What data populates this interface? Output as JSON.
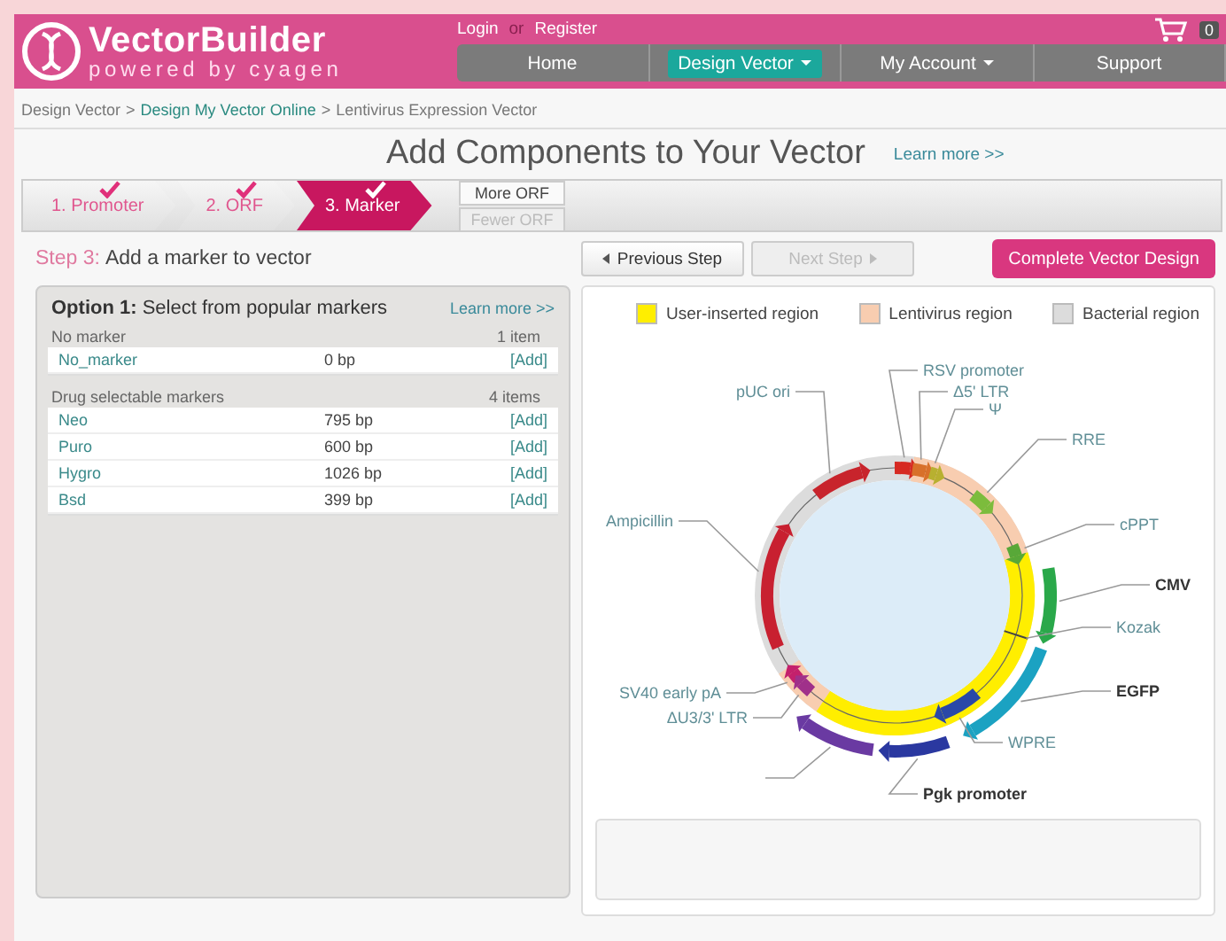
{
  "header": {
    "brand": "VectorBuilder",
    "tagline": "powered by cyagen",
    "login": "Login",
    "or": "or",
    "register": "Register",
    "cart_count": "0"
  },
  "nav": [
    {
      "label": "Home",
      "selected": false,
      "dropdown": false
    },
    {
      "label": "Design Vector",
      "selected": true,
      "dropdown": true
    },
    {
      "label": "My Account",
      "selected": false,
      "dropdown": true
    },
    {
      "label": "Support",
      "selected": false,
      "dropdown": false
    }
  ],
  "breadcrumb": [
    {
      "label": "Design Vector",
      "link": false
    },
    {
      "label": "Design My Vector Online",
      "link": true
    },
    {
      "label": "Lentivirus Expression Vector",
      "link": false
    }
  ],
  "breadcrumb_separator": ">",
  "title": "Add Components to Your Vector",
  "title_link": "Learn more >>",
  "steps": [
    {
      "label": "1. Promoter",
      "selected": false,
      "done": true
    },
    {
      "label": "2. ORF",
      "selected": false,
      "done": true
    },
    {
      "label": "3. Marker",
      "selected": true,
      "done": true
    }
  ],
  "orf_buttons": [
    {
      "label": "More ORF",
      "disabled": false
    },
    {
      "label": "Fewer ORF",
      "disabled": true
    }
  ],
  "step_heading": {
    "step": "Step 3:",
    "text": "Add a marker to vector"
  },
  "option": {
    "title": "**Option 1:** Select from popular markers",
    "link": "Learn more >>"
  },
  "marker_groups": [
    {
      "name": "No marker",
      "count": "1 item",
      "markers": [
        {
          "name": "No_marker",
          "size": "0 bp",
          "action": "[Add]"
        }
      ]
    },
    {
      "name": "Drug selectable markers",
      "count": "4 items",
      "markers": [
        {
          "name": "Neo",
          "size": "795 bp",
          "action": "[Add]"
        },
        {
          "name": "Puro",
          "size": "600 bp",
          "action": "[Add]"
        },
        {
          "name": "Hygro",
          "size": "1026 bp",
          "action": "[Add]"
        },
        {
          "name": "Bsd",
          "size": "399 bp",
          "action": "[Add]"
        }
      ]
    }
  ],
  "nav_buttons": [
    {
      "label": "Previous Step",
      "kind": "prev",
      "disabled": false
    },
    {
      "label": "Next Step",
      "kind": "next",
      "disabled": true
    }
  ],
  "complete_button": "Complete Vector Design",
  "legend": [
    {
      "label": "User-inserted region",
      "kind": "user",
      "color": "#ffee00"
    },
    {
      "label": "Lentivirus region",
      "kind": "lentivirus",
      "color": "#f8cdb0"
    },
    {
      "label": "Bacterial region",
      "kind": "bacterial",
      "color": "#dcdcdc"
    }
  ],
  "features": [
    {
      "label": "RSV promoter",
      "kind": "arrow",
      "user_inserted": false,
      "color": "#d62a22"
    },
    {
      "label": "pUC ori",
      "kind": "arrow",
      "user_inserted": false,
      "color": "#c8242c"
    },
    {
      "label": "Δ5' LTR",
      "kind": "arrow",
      "user_inserted": false,
      "color": "#d8702a"
    },
    {
      "label": "Ψ",
      "kind": "arrow",
      "user_inserted": false,
      "color": "#b8b030"
    },
    {
      "label": "RRE",
      "kind": "arrow",
      "user_inserted": false,
      "color": "#7cbc3c"
    },
    {
      "label": "Ampicillin",
      "kind": "arrow",
      "user_inserted": false,
      "color": "#c82030"
    },
    {
      "label": "cPPT",
      "kind": "arrow",
      "user_inserted": false,
      "color": "#58a838"
    },
    {
      "label": "CMV",
      "kind": "arrow",
      "user_inserted": true,
      "color": "#2aa84a"
    },
    {
      "label": "Kozak",
      "kind": "tick",
      "user_inserted": false,
      "color": "#444444"
    },
    {
      "label": "SV40 early pA",
      "kind": "arrow",
      "user_inserted": false,
      "color": "#c4206c"
    },
    {
      "label": "EGFP",
      "kind": "arrow",
      "user_inserted": true,
      "color": "#1ba2c2"
    },
    {
      "label": "ΔU3/3' LTR",
      "kind": "arrow",
      "user_inserted": false,
      "color": "#a0308a"
    },
    {
      "label": "WPRE",
      "kind": "arrow",
      "user_inserted": false,
      "color": "#2a48a8"
    },
    {
      "kind": "arrow",
      "color": "#6a3aa2"
    },
    {
      "label": "Pgk promoter",
      "kind": "arrow",
      "user_inserted": true,
      "color": "#2a38a0"
    }
  ]
}
